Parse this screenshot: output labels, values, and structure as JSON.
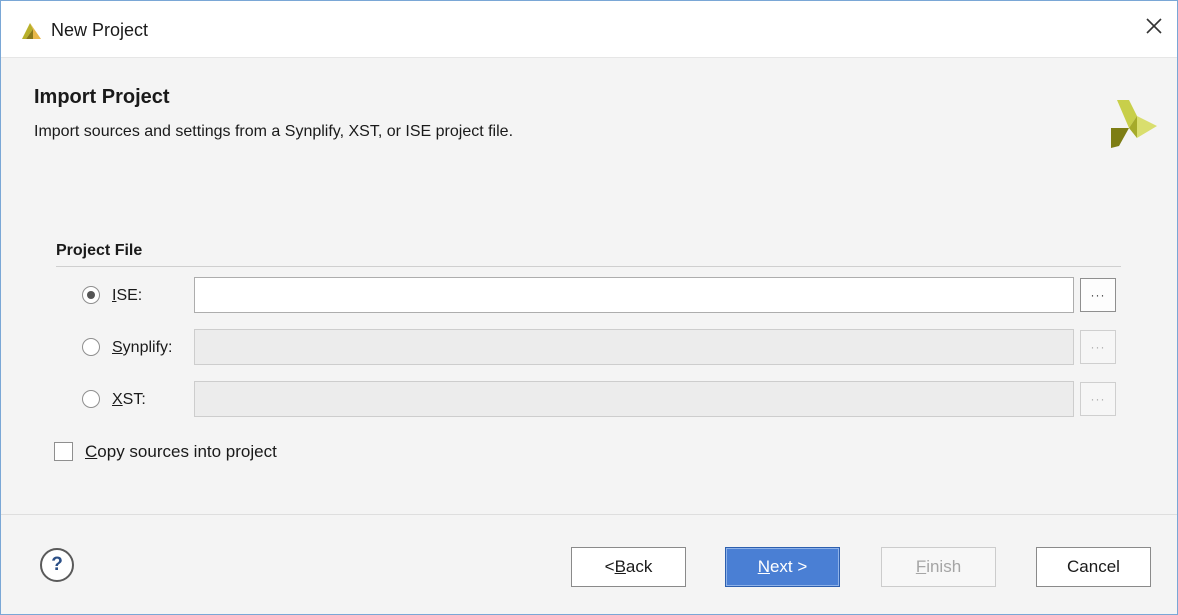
{
  "window": {
    "title": "New Project",
    "icon": "vivado-app-icon",
    "close_icon": "close-icon"
  },
  "header": {
    "title": "Import Project",
    "subtitle": "Import sources and settings from a Synplify, XST, or ISE project file.",
    "logo": "xilinx-logo-icon"
  },
  "project_file": {
    "group_title": "Project File",
    "options": [
      {
        "label_mnemonic": "I",
        "label_rest": "SE:",
        "selected": true,
        "value": "",
        "enabled": true
      },
      {
        "label_mnemonic": "S",
        "label_rest": "ynplify:",
        "selected": false,
        "value": "",
        "enabled": false
      },
      {
        "label_mnemonic": "X",
        "label_rest": "ST:",
        "selected": false,
        "value": "",
        "enabled": false
      }
    ],
    "browse_label": "···"
  },
  "copy_sources": {
    "mnemonic": "C",
    "label_rest": "opy sources into project",
    "checked": false
  },
  "footer": {
    "help_label": "?",
    "back_prefix": "< ",
    "back_mnemonic": "B",
    "back_rest": "ack",
    "next_mnemonic": "N",
    "next_rest": "ext >",
    "finish_mnemonic": "F",
    "finish_rest": "inish",
    "cancel_label": "Cancel"
  },
  "colors": {
    "accent": "#4a7fd4",
    "logo_dark": "#8a8a1a",
    "logo_light": "#c8cf4a"
  }
}
